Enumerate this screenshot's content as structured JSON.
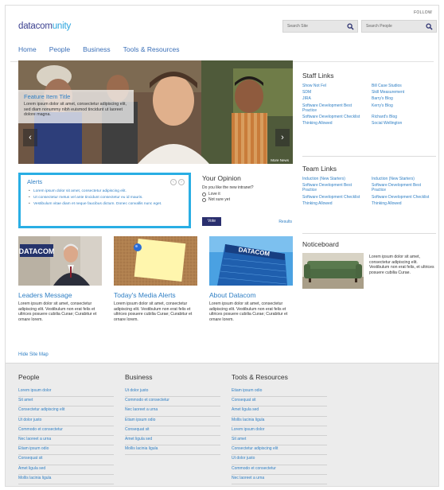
{
  "header": {
    "follow": "FOLLOW",
    "logo_main": "datacom",
    "logo_accent": "unity",
    "search_site_placeholder": "Search Site",
    "search_people_placeholder": "Search People"
  },
  "nav": [
    "Home",
    "People",
    "Business",
    "Tools & Resources"
  ],
  "hero": {
    "title": "Feature Item Title",
    "text": "Lorem ipsum dolor sit amet, consectetur adipiscing elit, sed diam nonummy nibh euismod tincidunt ut laoreet dolore magna.",
    "more": "More News"
  },
  "staff_links": {
    "title": "Staff Links",
    "items": [
      "Show Not Fel",
      "Bill Case Studios",
      "SDM",
      "Skill Measurement",
      "JIRA",
      "Barry's Blog",
      "Software Development Best Practice",
      "Kerry's Blog",
      "Software Development Checklist",
      "Richard's Blog",
      "Thinking Allowed",
      "Social Wellington"
    ]
  },
  "team_links": {
    "title": "Team Links",
    "items": [
      "Induction (New Starters)",
      "Induction (New Starters)",
      "Software Development Best Practice",
      "Software Development Best Practice",
      "Software Development Checklist",
      "Software Development Checklist",
      "Thinking Allowed",
      "Thinking Allowed"
    ]
  },
  "alerts": {
    "title": "Alerts",
    "items": [
      "Lorem ipsum dolor sit amet, consectetur adipiscing elit.",
      "Ut consectetur metus vel ante tincidunt consectetur eu id mauris.",
      "Vestibulum vitae diam et neque faucibus dictum. Donec convallis nunc eget."
    ]
  },
  "opinion": {
    "title": "Your Opinion",
    "question": "Do you like the new intranet?",
    "options": [
      "Love it",
      "Not sure yet"
    ],
    "vote": "Vote",
    "results": "Results"
  },
  "cards": [
    {
      "title": "Leaders Message",
      "text": "Lorem ipsum dolor sit amet, consectetur adipiscing elit. Vestibulum non erat felis et ultrices posuere cubilia Curae; Curabitur et ornare lorem."
    },
    {
      "title": "Today's Media Alerts",
      "text": "Lorem ipsum dolor sit amet, consectetur adipiscing elit. Vestibulum non erat felis et ultrices posuere cubilia Curae; Curabitur et ornare lorem."
    },
    {
      "title": "About Datacom",
      "text": "Lorem ipsum dolor sit amet, consectetur adipiscing elit. Vestibulum non erat felis et ultrices posuere cubilia Curae; Curabitur et ornare lorem."
    }
  ],
  "card_sign": "DATACOM",
  "noticeboard": {
    "title": "Noticeboard",
    "text": "Lorem ipsum dolor sit amet, consectetur adipiscing elit. Vestibulum non erat felis, et ultrices posuere cubilia Curae."
  },
  "hide_map": "Hide Site Map",
  "footer": {
    "people": {
      "title": "People",
      "items": [
        "Lorem ipsum dolor",
        "Sit amet",
        "Consectetur adipiscing elit",
        "Ut dolor justo",
        "Commodo et consectetur",
        "Nec laoreet a urna",
        "Etiam ipsum odio",
        "Consequat sit",
        "Amet ligula sed",
        "Mollis lacinia ligula"
      ]
    },
    "business": {
      "title": "Business",
      "items": [
        "Ut dolor justo",
        "Commodo et consectetur",
        "Nec laoreet a urna",
        "Etiam ipsum odio",
        "Consequat sit",
        "Amet ligula sed",
        "Mollis lacinia ligula"
      ]
    },
    "tools": {
      "title": "Tools & Resources",
      "items": [
        "Etiam ipsum odio",
        "Consequat sit",
        "Amet ligula sed",
        "Mollis lacinia ligula",
        "Lorem ipsum dolor",
        "Sit amet",
        "Consectetur adipiscing elit",
        "Ut dolor justo",
        "Commodo et consectetur",
        "Nec laoreet a urna"
      ]
    }
  }
}
